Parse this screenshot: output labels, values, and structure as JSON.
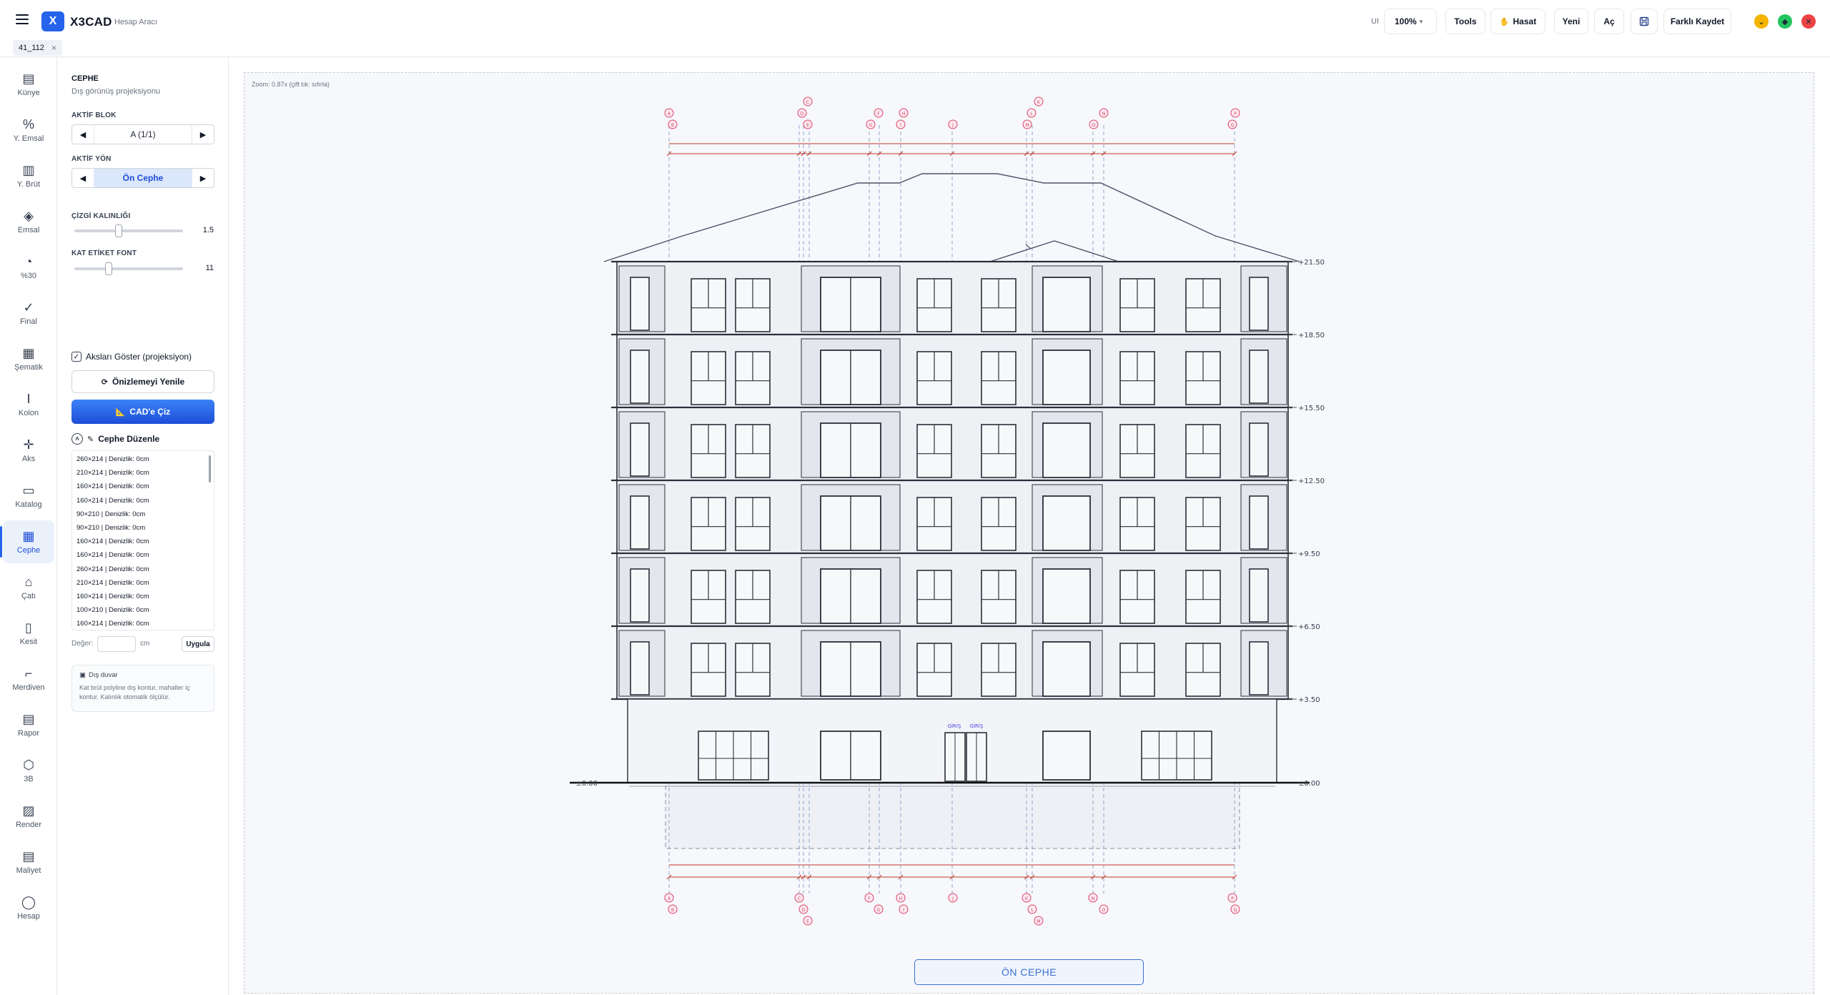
{
  "app": {
    "name": "X3CAD",
    "subtitle": "Hesap Aracı",
    "logo_glyph": "X"
  },
  "toolbar": {
    "ui_label": "UI",
    "zoom": "100%",
    "tools": "Tools",
    "hasat": "Hasat",
    "new": "Yeni",
    "open": "Aç",
    "save_as": "Farklı Kaydet"
  },
  "file_tab": {
    "label": "41_112",
    "close": "×"
  },
  "nav": [
    {
      "label": "Künye",
      "icon": "document-icon"
    },
    {
      "label": "Y. Emsal",
      "icon": "percent-icon"
    },
    {
      "label": "Y. Brüt",
      "icon": "bar-chart-icon"
    },
    {
      "label": "Emsal",
      "icon": "layers-icon"
    },
    {
      "label": "%30",
      "icon": "pie-chart-icon"
    },
    {
      "label": "Final",
      "icon": "check-circle-icon"
    },
    {
      "label": "Şematik",
      "icon": "building-icon"
    },
    {
      "label": "Kolon",
      "icon": "column-icon"
    },
    {
      "label": "Aks",
      "icon": "crosshair-icon"
    },
    {
      "label": "Katalog",
      "icon": "book-icon"
    },
    {
      "label": "Cephe",
      "icon": "grid-icon",
      "active": true
    },
    {
      "label": "Çatı",
      "icon": "home-icon"
    },
    {
      "label": "Kesit",
      "icon": "section-icon"
    },
    {
      "label": "Merdiven",
      "icon": "stairs-icon"
    },
    {
      "label": "Rapor",
      "icon": "report-icon"
    },
    {
      "label": "3B",
      "icon": "cube-icon"
    },
    {
      "label": "Render",
      "icon": "image-icon"
    },
    {
      "label": "Maliyet",
      "icon": "receipt-icon"
    },
    {
      "label": "Hesap",
      "icon": "user-icon"
    }
  ],
  "panel": {
    "title": "CEPHE",
    "subtitle": "Dış görünüş projeksiyonu",
    "active_block_label": "AKTİF BLOK",
    "active_block_value": "A (1/1)",
    "active_dir_label": "AKTİF YÖN",
    "active_dir_value": "Ön Cephe",
    "line_thickness_label": "ÇİZGİ KALINLIĞI",
    "line_thickness_value": "1.5",
    "line_thickness_level": 0.4,
    "floor_label_font_label": "KAT ETİKET FONT",
    "floor_label_font_value": "11",
    "floor_label_font_level": 0.3,
    "show_axes_label": "Aksları Göster (projeksiyon)",
    "show_axes_checked": true,
    "refresh_label": "Önizlemeyi Yenile",
    "cad_button": "CAD'e Çiz",
    "edit_section": "Cephe Düzenle",
    "openings": [
      "260×214 | Denizlik: 0cm",
      "210×214 | Denizlik: 0cm",
      "160×214 | Denizlik: 0cm",
      "160×214 | Denizlik: 0cm",
      "90×210 | Denizlik: 0cm",
      "90×210 | Denizlik: 0cm",
      "160×214 | Denizlik: 0cm",
      "160×214 | Denizlik: 0cm",
      "260×214 | Denizlik: 0cm",
      "210×214 | Denizlik: 0cm",
      "160×214 | Denizlik: 0cm",
      "100×210 | Denizlik: 0cm",
      "160×214 | Denizlik: 0cm"
    ],
    "value_label": "Değer:",
    "value_unit": "cm",
    "apply_button": "Uygula",
    "info_title": "Dış duvar",
    "info_text": "Kat brüt polyline dış kontur, mahaller iç kontur. Kalınlık otomatik ölçülür."
  },
  "canvas": {
    "zoom_note": "Zoom: 0.87x (çift tık: sıfırla)",
    "view_label": "ÖN CEPHE",
    "levels": [
      "+21.50",
      "+18.50",
      "+15.50",
      "+12.50",
      "+9.50",
      "+6.50",
      "+3.50",
      "±0.00",
      "±0.00"
    ],
    "entry_labels": [
      "GİRİŞ",
      "GİRİŞ"
    ],
    "axis_labels": [
      "A",
      "B",
      "C",
      "D",
      "E",
      "F",
      "G",
      "H",
      "I",
      "J",
      "K",
      "L",
      "M",
      "N",
      "O",
      "P",
      "Q",
      "R"
    ]
  },
  "colors": {
    "accent": "#2563eb",
    "axis": "#d9466f",
    "dim": "#c0392b",
    "win_yellow": "#f4b400",
    "win_green": "#22c55e",
    "win_red": "#ef4444"
  }
}
